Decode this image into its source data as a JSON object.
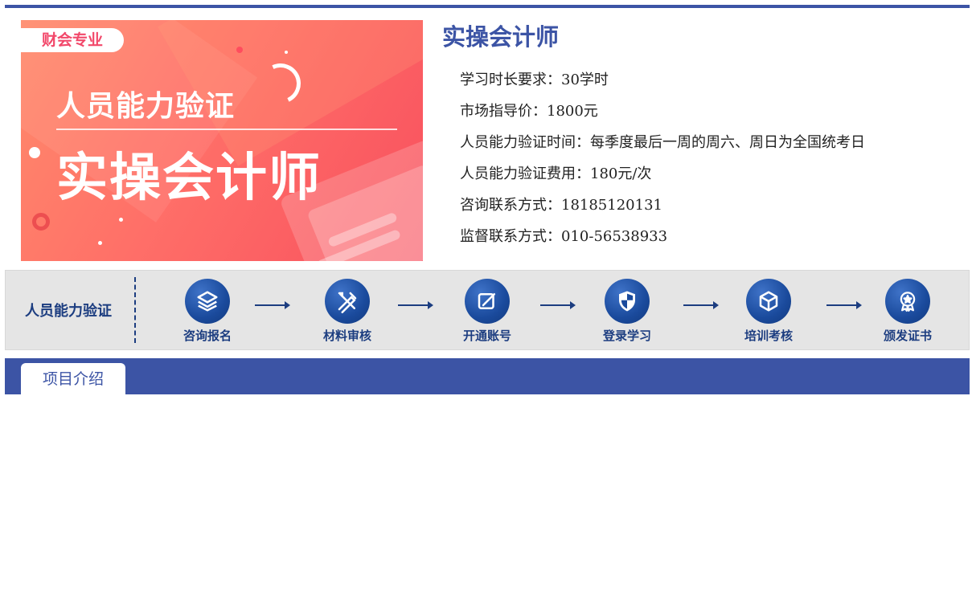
{
  "banner": {
    "tag": "财会专业",
    "subtitle": "人员能力验证",
    "main_title": "实操会计师"
  },
  "course": {
    "title": "实操会计师",
    "details": [
      {
        "label": "学习时长要求：",
        "value": "30学时"
      },
      {
        "label": "市场指导价：",
        "value": "1800元"
      },
      {
        "label": "人员能力验证时间：",
        "value": "每季度最后一周的周六、周日为全国统考日"
      },
      {
        "label": "人员能力验证费用：",
        "value": "180元/次"
      },
      {
        "label": "咨询联系方式：",
        "value": "18185120131"
      },
      {
        "label": "监督联系方式：",
        "value": "010-56538933"
      }
    ]
  },
  "process": {
    "label": "人员能力验证",
    "steps": [
      {
        "label": "咨询报名",
        "icon": "layers-icon"
      },
      {
        "label": "材料审核",
        "icon": "pencil-ruler-icon"
      },
      {
        "label": "开通账号",
        "icon": "edit-icon"
      },
      {
        "label": "登录学习",
        "icon": "shield-icon"
      },
      {
        "label": "培训考核",
        "icon": "cube-icon"
      },
      {
        "label": "颁发证书",
        "icon": "medal-icon"
      }
    ]
  },
  "tabs": [
    {
      "label": "项目介绍",
      "active": true
    }
  ],
  "colors": {
    "primary": "#3c54a5",
    "navy": "#1c3d80",
    "banner_red": "#f8505e"
  }
}
